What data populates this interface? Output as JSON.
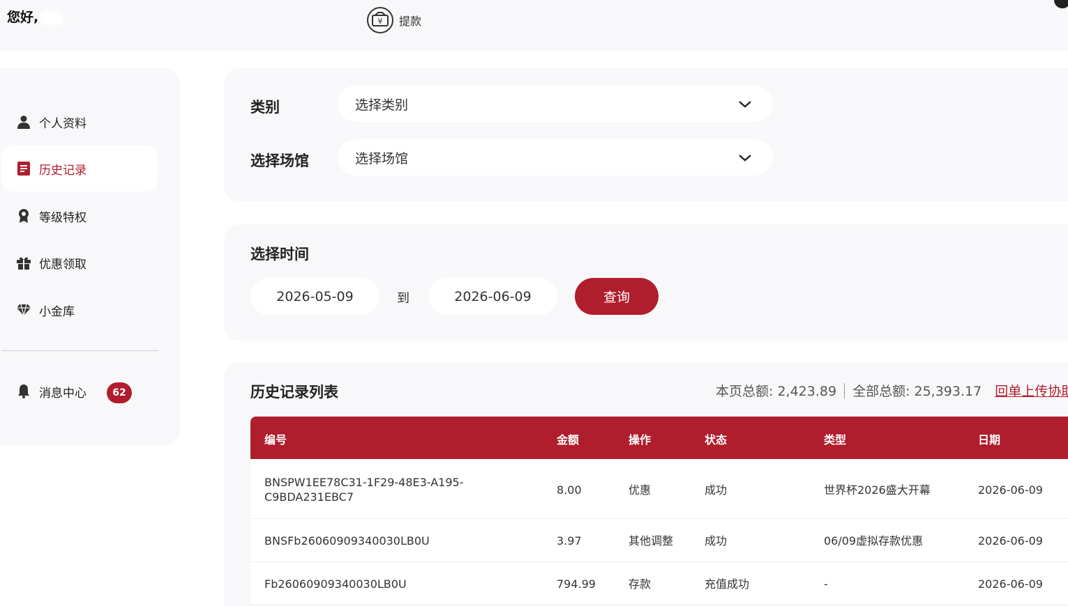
{
  "header": {
    "greeting": "您好,",
    "withdraw_label": "提款"
  },
  "sidebar": {
    "items": [
      {
        "label": "个人资料",
        "icon": "user-icon"
      },
      {
        "label": "历史记录",
        "icon": "document-icon",
        "active": true
      },
      {
        "label": "等级特权",
        "icon": "medal-icon"
      },
      {
        "label": "优惠领取",
        "icon": "gift-icon"
      },
      {
        "label": "小金库",
        "icon": "diamond-icon"
      }
    ],
    "messages": {
      "label": "消息中心",
      "icon": "bell-icon",
      "badge": "62"
    }
  },
  "filters": {
    "category": {
      "label": "类别",
      "placeholder": "选择类别"
    },
    "venue": {
      "label": "选择场馆",
      "placeholder": "选择场馆"
    }
  },
  "time": {
    "title": "选择时间",
    "start": "2026-05-09",
    "to_label": "到",
    "end": "2026-06-09",
    "query_label": "查询"
  },
  "history": {
    "title": "历史记录列表",
    "page_total": "本页总额: 2,423.89",
    "all_total": "全部总额: 25,393.17",
    "upload_link": "回单上传协助",
    "columns": [
      "编号",
      "金额",
      "操作",
      "状态",
      "类型",
      "日期"
    ],
    "rows": [
      {
        "id_line1": "BNSPW1EE78C31-1F29-48E3-A195-",
        "id_line2": "C9BDA231EBC7",
        "amount": "8.00",
        "action": "优惠",
        "status": "成功",
        "type": "世界杯2026盛大开幕",
        "date": "2026-06-09"
      },
      {
        "id_line1": "BNSFb26060909340030LB0U",
        "id_line2": "",
        "amount": "3.97",
        "action": "其他调整",
        "status": "成功",
        "type": "06/09虚拟存款优惠",
        "date": "2026-06-09"
      },
      {
        "id_line1": "Fb26060909340030LB0U",
        "id_line2": "",
        "amount": "794.99",
        "action": "存款",
        "status": "充值成功",
        "type": "-",
        "date": "2026-06-09"
      }
    ]
  },
  "colors": {
    "accent": "#b01d2c",
    "panel_bg": "#f8f8fa"
  }
}
